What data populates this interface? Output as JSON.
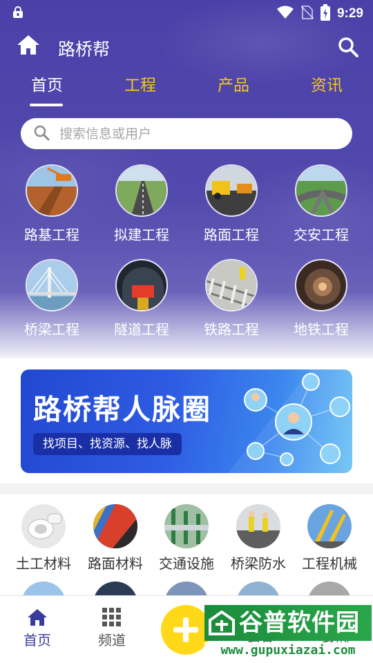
{
  "status_bar": {
    "time": "9:29"
  },
  "app_bar": {
    "title": "路桥帮"
  },
  "tabs": [
    {
      "label": "首页",
      "active": true
    },
    {
      "label": "工程",
      "active": false
    },
    {
      "label": "产品",
      "active": false
    },
    {
      "label": "资讯",
      "active": false
    }
  ],
  "search": {
    "placeholder": "搜索信息或用户"
  },
  "categories": [
    {
      "label": "路基工程",
      "icon": "roadbed-photo"
    },
    {
      "label": "拟建工程",
      "icon": "highway-photo"
    },
    {
      "label": "路面工程",
      "icon": "paving-photo"
    },
    {
      "label": "交安工程",
      "icon": "interchange-photo"
    },
    {
      "label": "桥梁工程",
      "icon": "bridge-photo"
    },
    {
      "label": "隧道工程",
      "icon": "tunnel-photo"
    },
    {
      "label": "铁路工程",
      "icon": "railway-photo"
    },
    {
      "label": "地铁工程",
      "icon": "subway-photo"
    }
  ],
  "banner": {
    "title": "路桥帮人脉圈",
    "subtitle": "找项目、找资源、找人脉"
  },
  "materials": [
    {
      "label": "土工材料",
      "icon": "pipe-photo"
    },
    {
      "label": "路面材料",
      "icon": "colored-aggregate-photo"
    },
    {
      "label": "交通设施",
      "icon": "guardrail-photo"
    },
    {
      "label": "桥梁防水",
      "icon": "workers-photo"
    },
    {
      "label": "工程机械",
      "icon": "crane-photo"
    }
  ],
  "bottom_nav": {
    "home": "首页",
    "channel": "频道",
    "card": "名片",
    "mine": "我的"
  },
  "watermark": {
    "text": "谷普软件园",
    "url": "www.gupuxiazai.com"
  },
  "colors": {
    "header_purple": "#4b40a8",
    "tab_yellow": "#f6c81c",
    "plus_yellow": "#ffd919",
    "nav_active": "#3a3c9c"
  }
}
